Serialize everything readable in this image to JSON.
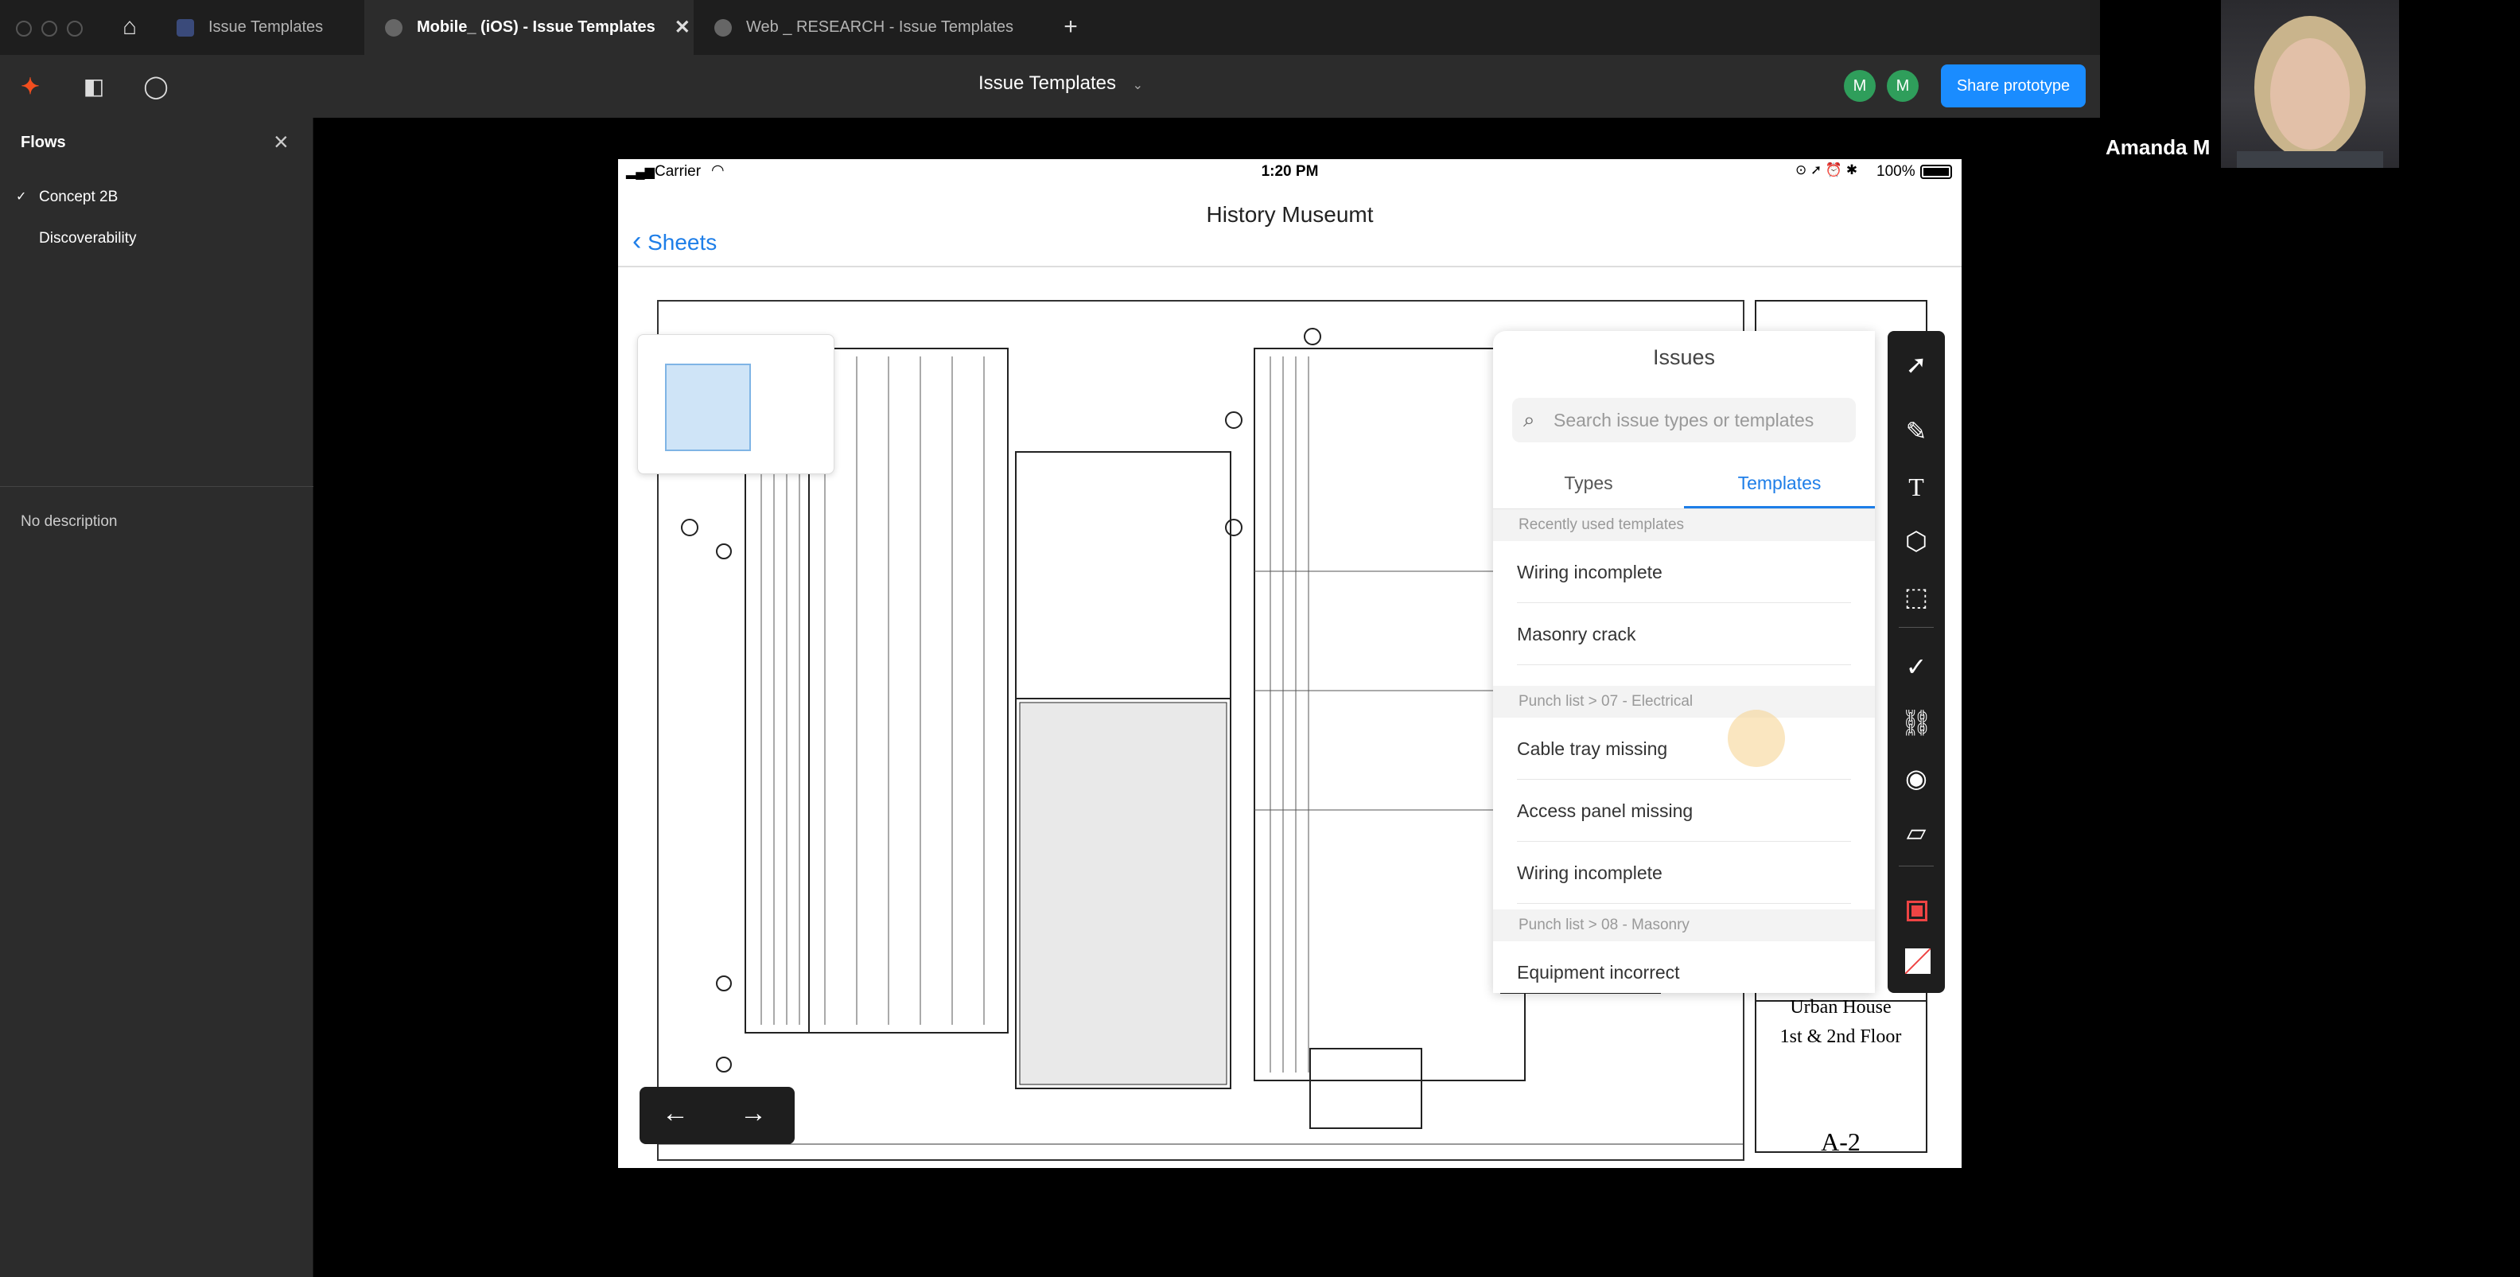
{
  "tabs": [
    {
      "label": "Issue Templates",
      "active": false
    },
    {
      "label": "Mobile_ (iOS) - Issue Templates",
      "active": true
    },
    {
      "label": "Web _ RESEARCH - Issue Templates",
      "active": false
    }
  ],
  "toolbar": {
    "title": "Issue Templates",
    "avatars": [
      "M",
      "M"
    ],
    "share_label": "Share prototype"
  },
  "flows": {
    "header": "Flows",
    "items": [
      {
        "label": "Concept 2B",
        "checked": true
      },
      {
        "label": "Discoverability",
        "checked": false
      }
    ],
    "description": "No description"
  },
  "presenter": {
    "name": "Amanda M"
  },
  "ipad": {
    "status": {
      "carrier": "Carrier",
      "time": "1:20 PM",
      "battery": "100%"
    },
    "nav": {
      "back_label": "Sheets",
      "title": "History Museumt"
    },
    "titleblock": {
      "line1": "Urban House",
      "line2": "1st & 2nd Floor",
      "sheet": "A-2"
    }
  },
  "issues": {
    "title": "Issues",
    "search_placeholder": "Search issue types or templates",
    "tabs": {
      "types": "Types",
      "templates": "Templates"
    },
    "sections": [
      {
        "header": "Recently used templates",
        "items": [
          "Wiring incomplete",
          "Masonry crack"
        ]
      },
      {
        "header": "Punch list > 07 - Electrical",
        "items": [
          "Cable tray missing",
          "Access panel missing",
          "Wiring incomplete"
        ]
      },
      {
        "header": "Punch list > 08 - Masonry",
        "items": [
          "Equipment incorrect"
        ]
      }
    ]
  },
  "icons": {
    "tools": [
      "cursor-icon",
      "pen-icon",
      "text-icon",
      "shapes-icon",
      "lasso-icon",
      "checkmark-icon",
      "link-icon",
      "camera-icon",
      "ruler-icon",
      "fill-color-icon",
      "stroke-color-icon"
    ]
  },
  "colors": {
    "accent": "#1e7ee8",
    "share": "#1a8cff",
    "avatar": "#2f9e5b"
  }
}
